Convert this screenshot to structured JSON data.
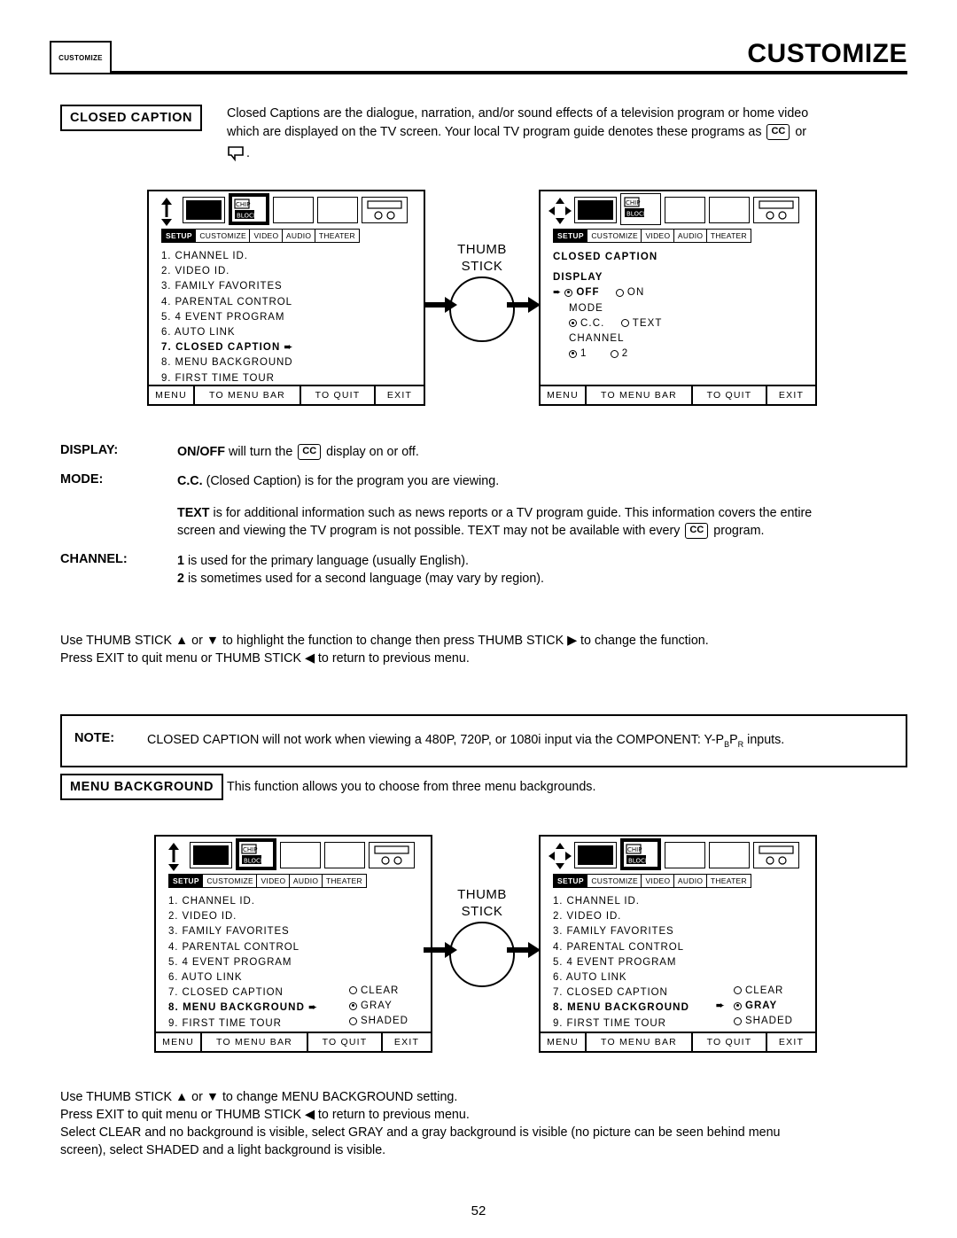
{
  "header": {
    "tab_label": "CUSTOMIZE",
    "title": "CUSTOMIZE"
  },
  "closed_caption": {
    "heading": "CLOSED CAPTION",
    "para_line1": "Closed Captions are the dialogue, narration, and/or sound effects of a television program or home video",
    "para_line2_a": "which are displayed on the TV screen.  Your local TV program guide denotes these programs as",
    "cc_glyph": "CC",
    "para_line2_b": "or",
    "para_line3": "."
  },
  "menu_screen_1": {
    "tabs": [
      "SETUP",
      "CUSTOMIZE",
      "VIDEO",
      "AUDIO",
      "THEATER"
    ],
    "selected_tab": "SETUP",
    "items": [
      "1. CHANNEL ID.",
      "2. VIDEO ID.",
      "3. FAMILY FAVORITES",
      "4. PARENTAL CONTROL",
      "5. 4 EVENT PROGRAM",
      "6. AUTO LINK",
      "7. CLOSED CAPTION",
      "8. MENU BACKGROUND",
      "9. FIRST TIME TOUR"
    ],
    "highlighted_index": 6,
    "footer": [
      "MENU",
      "TO MENU BAR",
      "TO QUIT",
      "EXIT"
    ]
  },
  "menu_screen_2": {
    "tabs": [
      "SETUP",
      "CUSTOMIZE",
      "VIDEO",
      "AUDIO",
      "THEATER"
    ],
    "selected_tab": "SETUP",
    "title": "CLOSED CAPTION",
    "groups": [
      {
        "label": "DISPLAY",
        "options": [
          "OFF",
          "ON"
        ],
        "selected": "OFF",
        "pointer": true
      },
      {
        "label": "MODE",
        "options": [
          "C.C.",
          "TEXT"
        ],
        "selected": "C.C.",
        "pointer": false
      },
      {
        "label": "CHANNEL",
        "options": [
          "1",
          "2"
        ],
        "selected": "1",
        "pointer": false
      }
    ],
    "footer": [
      "MENU",
      "TO MENU BAR",
      "TO QUIT",
      "EXIT"
    ]
  },
  "thumbstick_label_line1": "THUMB",
  "thumbstick_label_line2": "STICK",
  "definitions": [
    {
      "label": "DISPLAY:",
      "text_a": "ON/OFF",
      "text_b": "will turn the",
      "cc": "CC",
      "text_c": "display on or off."
    },
    {
      "label": "MODE:",
      "text_a": "C.C.",
      "text_b": "(Closed Caption) is for the program you are viewing."
    }
  ],
  "text_para": {
    "line1_a": "TEXT",
    "line1_b": "is for additional information such as news reports or a TV program guide.  This information covers the entire",
    "line2_a": "screen and viewing the TV program is not possible.  TEXT may not be available with every",
    "cc": "CC",
    "line2_b": "program."
  },
  "channel_def": {
    "label": "CHANNEL:",
    "line1_a": "1",
    "line1_b": "is used for the primary language (usually English).",
    "line2_a": "2",
    "line2_b": "is sometimes used for a second language (may vary by region)."
  },
  "usage_1": {
    "line1": "Use THUMB STICK ▲ or ▼ to highlight the function to change then press THUMB STICK ▶ to change the function.",
    "line2": "Press EXIT to quit menu or THUMB STICK ◀ to return to previous menu."
  },
  "note": {
    "label": "NOTE:",
    "text_a": "CLOSED CAPTION will not work when viewing a 480P, 720P, or 1080i input via the COMPONENT: Y-P",
    "sub_b": "B",
    "text_b": "P",
    "sub_r": "R",
    "text_c": "inputs."
  },
  "menu_background": {
    "heading": "MENU BACKGROUND",
    "description": "This function allows you to choose from three menu backgrounds."
  },
  "menu_screen_3": {
    "tabs": [
      "SETUP",
      "CUSTOMIZE",
      "VIDEO",
      "AUDIO",
      "THEATER"
    ],
    "selected_tab": "SETUP",
    "items": [
      "1. CHANNEL ID.",
      "2. VIDEO ID.",
      "3. FAMILY FAVORITES",
      "4. PARENTAL CONTROL",
      "5. 4 EVENT PROGRAM",
      "6. AUTO LINK",
      "7. CLOSED CAPTION",
      "8. MENU BACKGROUND",
      "9. FIRST TIME TOUR"
    ],
    "highlighted_index": 7,
    "options": [
      "CLEAR",
      "GRAY",
      "SHADED"
    ],
    "selected_option": "GRAY",
    "option_pointer": false,
    "footer": [
      "MENU",
      "TO MENU BAR",
      "TO QUIT",
      "EXIT"
    ]
  },
  "menu_screen_4": {
    "tabs": [
      "SETUP",
      "CUSTOMIZE",
      "VIDEO",
      "AUDIO",
      "THEATER"
    ],
    "selected_tab": "SETUP",
    "items": [
      "1. CHANNEL ID.",
      "2. VIDEO ID.",
      "3. FAMILY FAVORITES",
      "4. PARENTAL CONTROL",
      "5. 4 EVENT PROGRAM",
      "6. AUTO LINK",
      "7. CLOSED CAPTION",
      "8. MENU BACKGROUND",
      "9. FIRST TIME TOUR"
    ],
    "highlighted_index": 7,
    "options": [
      "CLEAR",
      "GRAY",
      "SHADED"
    ],
    "selected_option": "GRAY",
    "option_pointer": true,
    "footer": [
      "MENU",
      "TO MENU BAR",
      "TO QUIT",
      "EXIT"
    ]
  },
  "usage_2": {
    "line1": "Use THUMB STICK ▲ or ▼ to change MENU BACKGROUND setting.",
    "line2": "Press EXIT to quit menu or THUMB STICK ◀ to return to previous menu.",
    "line3": "Select CLEAR and no background is visible, select GRAY and a gray background is visible (no picture can be seen behind menu",
    "line4": "screen), select SHADED and a light background is visible."
  },
  "page_number": "52"
}
